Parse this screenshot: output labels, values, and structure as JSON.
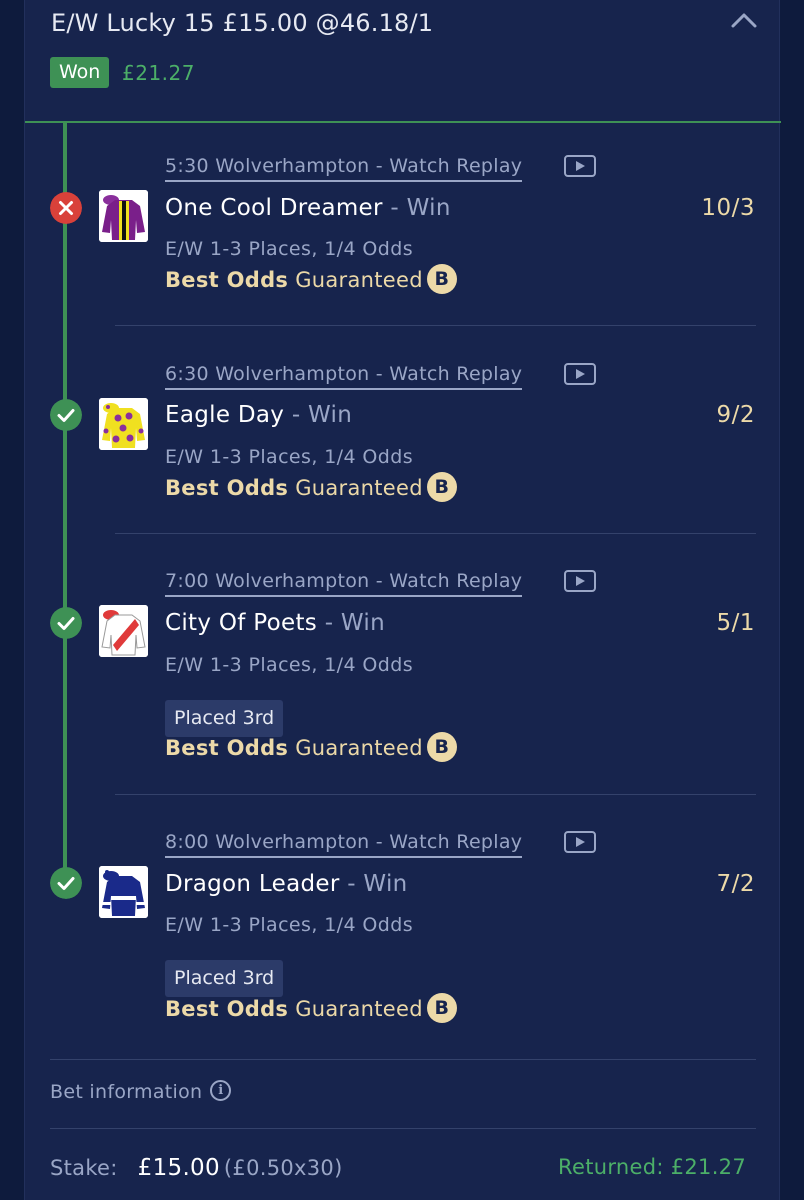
{
  "bet": {
    "title": "E/W Lucky 15 £15.00 @46.18/1",
    "status": "Won",
    "winnings": "£21.27"
  },
  "legs": [
    {
      "race": "5:30 Wolverhampton - Watch Replay",
      "horse": "One Cool Dreamer",
      "market": " - Win",
      "odds": "10/3",
      "terms": "E/W 1-3 Places, 1/4 Odds",
      "result": "lost",
      "result_icon": "cross-icon",
      "placed": null
    },
    {
      "race": "6:30 Wolverhampton - Watch Replay",
      "horse": "Eagle Day",
      "market": " - Win",
      "odds": "9/2",
      "terms": "E/W 1-3 Places, 1/4 Odds",
      "result": "won",
      "result_icon": "check-icon",
      "placed": null
    },
    {
      "race": "7:00 Wolverhampton - Watch Replay",
      "horse": "City Of Poets",
      "market": " - Win",
      "odds": "5/1",
      "terms": "E/W 1-3 Places, 1/4 Odds",
      "result": "won",
      "result_icon": "check-icon",
      "placed": "Placed 3rd"
    },
    {
      "race": "8:00 Wolverhampton - Watch Replay",
      "horse": "Dragon Leader",
      "market": " - Win",
      "odds": "7/2",
      "terms": "E/W 1-3 Places, 1/4 Odds",
      "result": "won",
      "result_icon": "check-icon",
      "placed": "Placed 3rd"
    }
  ],
  "bog": {
    "strong": "Best Odds",
    "rest": " Guaranteed",
    "icon_letter": "B"
  },
  "bet_information": {
    "label": "Bet information",
    "icon_letter": "i"
  },
  "stake": {
    "label": "Stake:",
    "value": "£15.00",
    "breakdown": "(£0.50x30)",
    "returned": "Returned: £21.27"
  },
  "colors": {
    "background": "#0e1b3d",
    "card": "#17244d",
    "won_green": "#3e9155",
    "lost_red": "#d9413a",
    "odds_gold": "#ecd9a8",
    "muted_text": "#9aa6c6"
  },
  "icons": [
    "chevron-up-icon",
    "cross-icon",
    "check-icon",
    "play-replay-icon",
    "best-odds-b-icon",
    "info-icon",
    "jockey-silks-icon"
  ]
}
